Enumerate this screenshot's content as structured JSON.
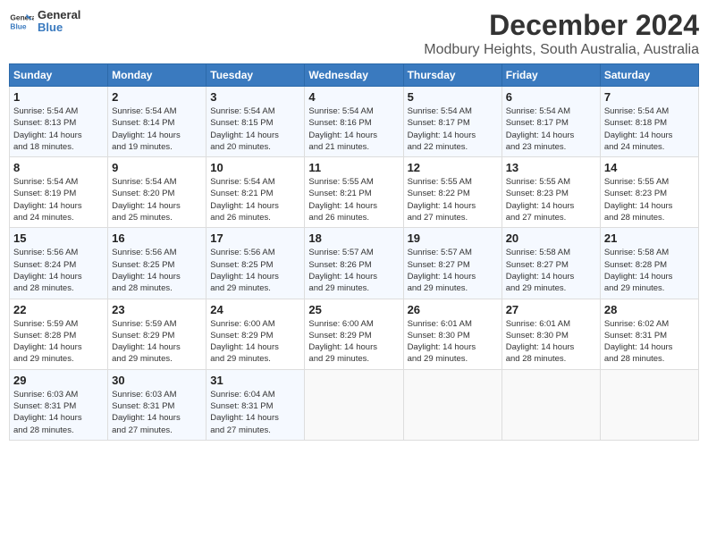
{
  "logo": {
    "line1": "General",
    "line2": "Blue"
  },
  "title": "December 2024",
  "subtitle": "Modbury Heights, South Australia, Australia",
  "headers": [
    "Sunday",
    "Monday",
    "Tuesday",
    "Wednesday",
    "Thursday",
    "Friday",
    "Saturday"
  ],
  "weeks": [
    [
      {
        "day": "1",
        "info": "Sunrise: 5:54 AM\nSunset: 8:13 PM\nDaylight: 14 hours\nand 18 minutes."
      },
      {
        "day": "2",
        "info": "Sunrise: 5:54 AM\nSunset: 8:14 PM\nDaylight: 14 hours\nand 19 minutes."
      },
      {
        "day": "3",
        "info": "Sunrise: 5:54 AM\nSunset: 8:15 PM\nDaylight: 14 hours\nand 20 minutes."
      },
      {
        "day": "4",
        "info": "Sunrise: 5:54 AM\nSunset: 8:16 PM\nDaylight: 14 hours\nand 21 minutes."
      },
      {
        "day": "5",
        "info": "Sunrise: 5:54 AM\nSunset: 8:17 PM\nDaylight: 14 hours\nand 22 minutes."
      },
      {
        "day": "6",
        "info": "Sunrise: 5:54 AM\nSunset: 8:17 PM\nDaylight: 14 hours\nand 23 minutes."
      },
      {
        "day": "7",
        "info": "Sunrise: 5:54 AM\nSunset: 8:18 PM\nDaylight: 14 hours\nand 24 minutes."
      }
    ],
    [
      {
        "day": "8",
        "info": "Sunrise: 5:54 AM\nSunset: 8:19 PM\nDaylight: 14 hours\nand 24 minutes."
      },
      {
        "day": "9",
        "info": "Sunrise: 5:54 AM\nSunset: 8:20 PM\nDaylight: 14 hours\nand 25 minutes."
      },
      {
        "day": "10",
        "info": "Sunrise: 5:54 AM\nSunset: 8:21 PM\nDaylight: 14 hours\nand 26 minutes."
      },
      {
        "day": "11",
        "info": "Sunrise: 5:55 AM\nSunset: 8:21 PM\nDaylight: 14 hours\nand 26 minutes."
      },
      {
        "day": "12",
        "info": "Sunrise: 5:55 AM\nSunset: 8:22 PM\nDaylight: 14 hours\nand 27 minutes."
      },
      {
        "day": "13",
        "info": "Sunrise: 5:55 AM\nSunset: 8:23 PM\nDaylight: 14 hours\nand 27 minutes."
      },
      {
        "day": "14",
        "info": "Sunrise: 5:55 AM\nSunset: 8:23 PM\nDaylight: 14 hours\nand 28 minutes."
      }
    ],
    [
      {
        "day": "15",
        "info": "Sunrise: 5:56 AM\nSunset: 8:24 PM\nDaylight: 14 hours\nand 28 minutes."
      },
      {
        "day": "16",
        "info": "Sunrise: 5:56 AM\nSunset: 8:25 PM\nDaylight: 14 hours\nand 28 minutes."
      },
      {
        "day": "17",
        "info": "Sunrise: 5:56 AM\nSunset: 8:25 PM\nDaylight: 14 hours\nand 29 minutes."
      },
      {
        "day": "18",
        "info": "Sunrise: 5:57 AM\nSunset: 8:26 PM\nDaylight: 14 hours\nand 29 minutes."
      },
      {
        "day": "19",
        "info": "Sunrise: 5:57 AM\nSunset: 8:27 PM\nDaylight: 14 hours\nand 29 minutes."
      },
      {
        "day": "20",
        "info": "Sunrise: 5:58 AM\nSunset: 8:27 PM\nDaylight: 14 hours\nand 29 minutes."
      },
      {
        "day": "21",
        "info": "Sunrise: 5:58 AM\nSunset: 8:28 PM\nDaylight: 14 hours\nand 29 minutes."
      }
    ],
    [
      {
        "day": "22",
        "info": "Sunrise: 5:59 AM\nSunset: 8:28 PM\nDaylight: 14 hours\nand 29 minutes."
      },
      {
        "day": "23",
        "info": "Sunrise: 5:59 AM\nSunset: 8:29 PM\nDaylight: 14 hours\nand 29 minutes."
      },
      {
        "day": "24",
        "info": "Sunrise: 6:00 AM\nSunset: 8:29 PM\nDaylight: 14 hours\nand 29 minutes."
      },
      {
        "day": "25",
        "info": "Sunrise: 6:00 AM\nSunset: 8:29 PM\nDaylight: 14 hours\nand 29 minutes."
      },
      {
        "day": "26",
        "info": "Sunrise: 6:01 AM\nSunset: 8:30 PM\nDaylight: 14 hours\nand 29 minutes."
      },
      {
        "day": "27",
        "info": "Sunrise: 6:01 AM\nSunset: 8:30 PM\nDaylight: 14 hours\nand 28 minutes."
      },
      {
        "day": "28",
        "info": "Sunrise: 6:02 AM\nSunset: 8:31 PM\nDaylight: 14 hours\nand 28 minutes."
      }
    ],
    [
      {
        "day": "29",
        "info": "Sunrise: 6:03 AM\nSunset: 8:31 PM\nDaylight: 14 hours\nand 28 minutes."
      },
      {
        "day": "30",
        "info": "Sunrise: 6:03 AM\nSunset: 8:31 PM\nDaylight: 14 hours\nand 27 minutes."
      },
      {
        "day": "31",
        "info": "Sunrise: 6:04 AM\nSunset: 8:31 PM\nDaylight: 14 hours\nand 27 minutes."
      },
      null,
      null,
      null,
      null
    ]
  ]
}
